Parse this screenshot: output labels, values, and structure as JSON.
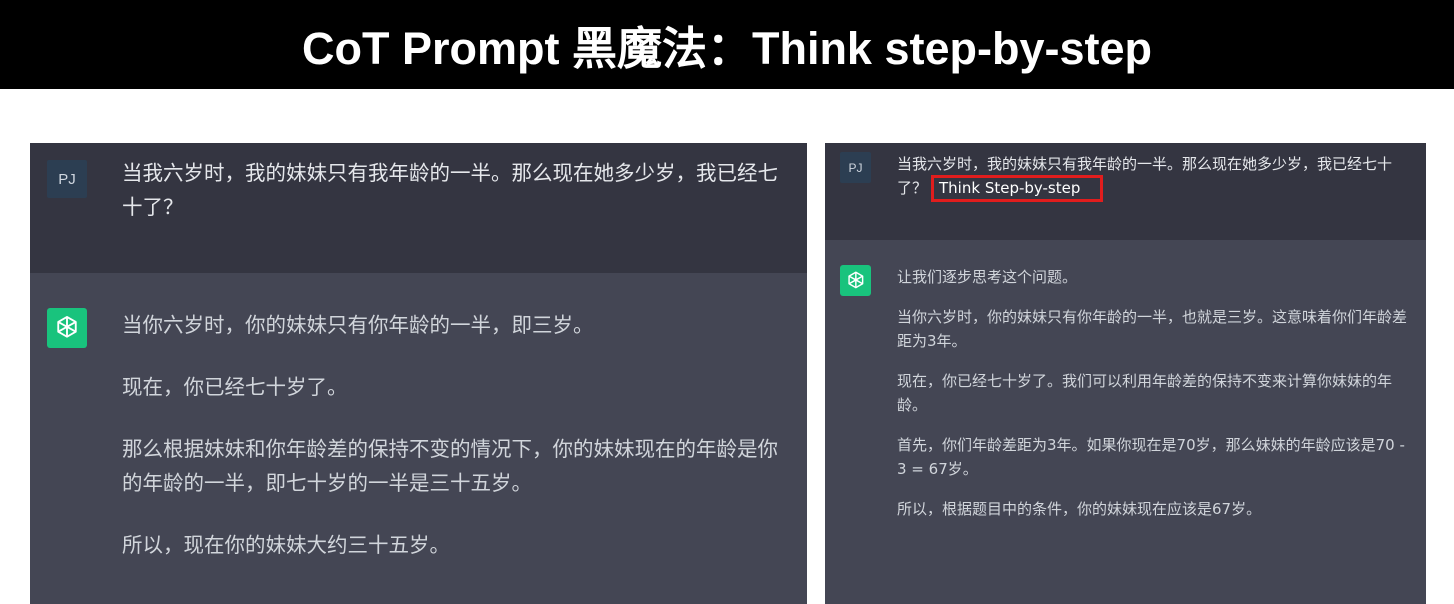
{
  "banner": {
    "title": "CoT Prompt 黑魔法：Think step-by-step"
  },
  "left_panel": {
    "user": {
      "avatar": "PJ",
      "message": "当我六岁时，我的妹妹只有我年龄的一半。那么现在她多少岁，我已经七十了？"
    },
    "assistant": {
      "icon": "openai-logo-icon",
      "paragraphs": [
        "当你六岁时，你的妹妹只有你年龄的一半，即三岁。",
        "现在，你已经七十岁了。",
        "那么根据妹妹和你年龄差的保持不变的情况下，你的妹妹现在的年龄是你的年龄的一半，即七十岁的一半是三十五岁。",
        "所以，现在你的妹妹大约三十五岁。"
      ]
    }
  },
  "right_panel": {
    "user": {
      "avatar": "PJ",
      "message": "当我六岁时，我的妹妹只有我年龄的一半。那么现在她多少岁，我已经七十了？",
      "highlight": "Think Step-by-step",
      "highlight_color": "#e11d1d"
    },
    "assistant": {
      "icon": "openai-logo-icon",
      "paragraphs": [
        "让我们逐步思考这个问题。",
        "当你六岁时，你的妹妹只有你年龄的一半，也就是三岁。这意味着你们年龄差距为3年。",
        "现在，你已经七十岁了。我们可以利用年龄差的保持不变来计算你妹妹的年龄。",
        "首先，你们年龄差距为3年。如果你现在是70岁，那么妹妹的年龄应该是70 - 3 = 67岁。",
        "所以，根据题目中的条件，你的妹妹现在应该是67岁。"
      ]
    }
  },
  "colors": {
    "user_bg": "#343541",
    "assistant_bg": "#444654",
    "gpt_green": "#19c37d",
    "user_avatar_bg": "#2c3e52"
  }
}
